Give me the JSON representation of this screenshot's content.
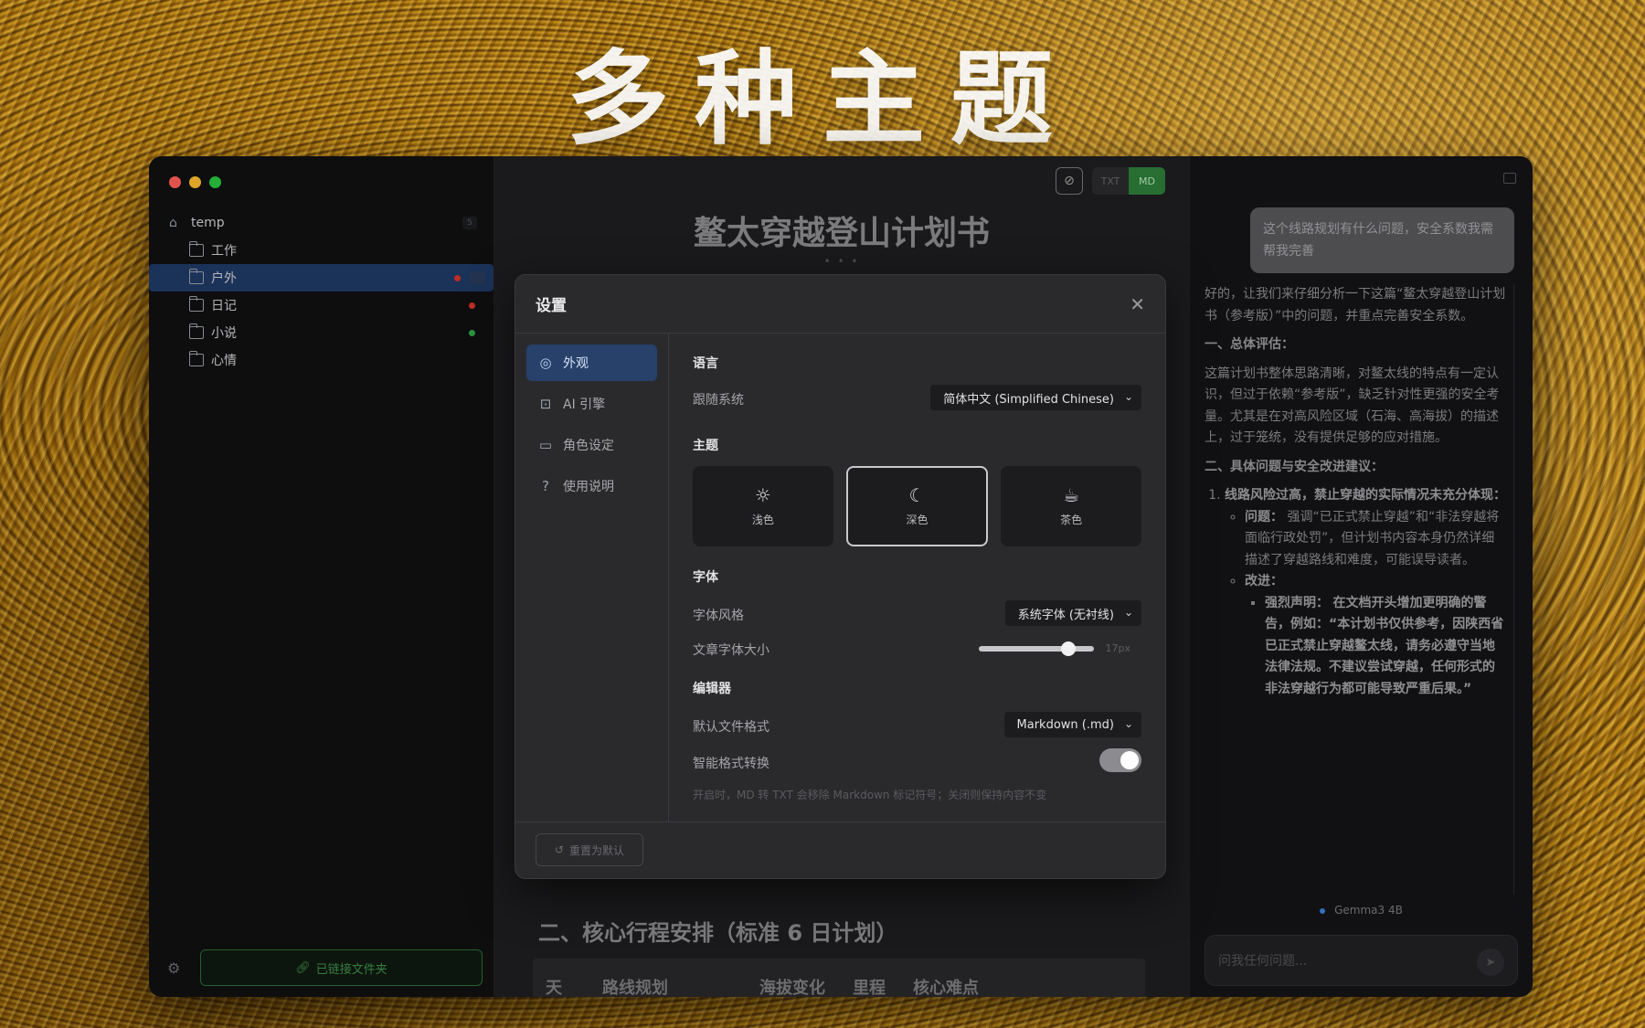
{
  "hero_title": "多种主题",
  "sidebar": {
    "root": "temp",
    "folders": [
      {
        "label": "工作",
        "dot": ""
      },
      {
        "label": "户外",
        "dot": "red"
      },
      {
        "label": "日记",
        "dot": "red"
      },
      {
        "label": "小说",
        "dot": "green"
      },
      {
        "label": "心情",
        "dot": ""
      }
    ],
    "linked_label": "已链接文件夹"
  },
  "editor": {
    "format_txt": "TXT",
    "format_md": "MD",
    "doc_title": "鳌太穿越登山计划书",
    "ellipsis": "• • •",
    "section_heading": "二、核心行程安排（标准 6 日计划）",
    "table_headers": [
      "天",
      "路线规划",
      "海拔变化",
      "里程",
      "核心难点"
    ]
  },
  "settings": {
    "title": "设置",
    "nav": [
      {
        "label": "外观",
        "icon": "palette-icon",
        "glyph": "◎"
      },
      {
        "label": "AI 引擎",
        "icon": "robot-icon",
        "glyph": "⊡"
      },
      {
        "label": "角色设定",
        "icon": "chat-icon",
        "glyph": "▭"
      },
      {
        "label": "使用说明",
        "icon": "help-icon",
        "glyph": "?"
      }
    ],
    "language": {
      "section": "语言",
      "label": "跟随系统",
      "value": "简体中文 (Simplified Chinese)"
    },
    "theme": {
      "section": "主题",
      "options": [
        {
          "label": "浅色",
          "glyph": "☼"
        },
        {
          "label": "深色",
          "glyph": "☾"
        },
        {
          "label": "茶色",
          "glyph": "☕"
        }
      ],
      "selected": "深色"
    },
    "font": {
      "section": "字体",
      "style_label": "字体风格",
      "style_value": "系统字体 (无衬线)",
      "size_label": "文章字体大小",
      "size_value": "17px",
      "size_fraction": 0.78
    },
    "editor": {
      "section": "编辑器",
      "format_label": "默认文件格式",
      "format_value": "Markdown (.md)",
      "smart_label": "智能格式转换",
      "smart_on": true,
      "hint": "开启时，MD 转 TXT 会移除 Markdown 标记符号；关闭则保持内容不变"
    },
    "reset_label": "重置为默认"
  },
  "chat": {
    "user_message": "这个线路规划有什么问题，安全系数我需帮我完善",
    "reply_intro": "好的，让我们来仔细分析一下这篇“鳌太穿越登山计划书（参考版）”中的问题，并重点完善安全系数。",
    "h1": "一、总体评估：",
    "p1": "这篇计划书整体思路清晰，对鳌太线的特点有一定认识，但过于依赖“参考版”，缺乏针对性更强的安全考量。尤其是在对高风险区域（石海、高海拔）的描述上，过于笼统，没有提供足够的应对措施。",
    "h2": "二、具体问题与安全改进建议：",
    "item1": "线路风险过高，禁止穿越的实际情况未充分体现：",
    "problem_label": "问题：",
    "problem_text": "强调“已正式禁止穿越”和“非法穿越将面临行政处罚”，但计划书内容本身仍然详细描述了穿越路线和难度，可能误导读者。",
    "improve_label": "改进：",
    "strong_label": "强烈声明：",
    "strong_text": "在文档开头增加更明确的警告，例如：“本计划书仅供参考，因陕西省已正式禁止穿越鳌太线，请务必遵守当地法律法规。不建议尝试穿越，任何形式的非法穿越行为都可能导致严重后果。”",
    "model": "Gemma3 4B",
    "input_placeholder": "问我任何问题..."
  }
}
